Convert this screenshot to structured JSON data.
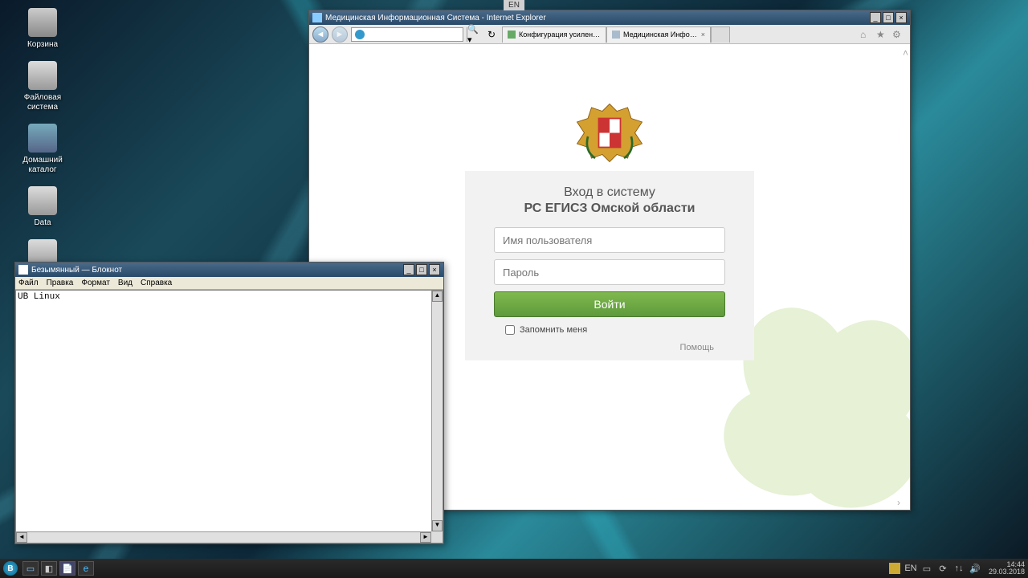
{
  "lang_top": "EN",
  "desktop_icons": [
    {
      "label": "Корзина"
    },
    {
      "label": "Файловая система"
    },
    {
      "label": "Домашний каталог"
    },
    {
      "label": "Data"
    },
    {
      "label": ""
    }
  ],
  "browser": {
    "title": "Медицинская Информационная Система - Internet Explorer",
    "tabs": [
      {
        "label": "Конфигурация усиленной без..."
      },
      {
        "label": "Медицинская Информацио..."
      }
    ],
    "login": {
      "title": "Вход в систему",
      "subtitle": "РС ЕГИСЗ Омской области",
      "username_ph": "Имя пользователя",
      "password_ph": "Пароль",
      "submit": "Войти",
      "remember": "Запомнить меня",
      "help": "Помощь"
    }
  },
  "notepad": {
    "title": "Безымянный — Блокнот",
    "menu": [
      "Файл",
      "Правка",
      "Формат",
      "Вид",
      "Справка"
    ],
    "content": "UB Linux"
  },
  "tray": {
    "lang": "EN",
    "time": "14:44",
    "date": "29.03.2018"
  }
}
